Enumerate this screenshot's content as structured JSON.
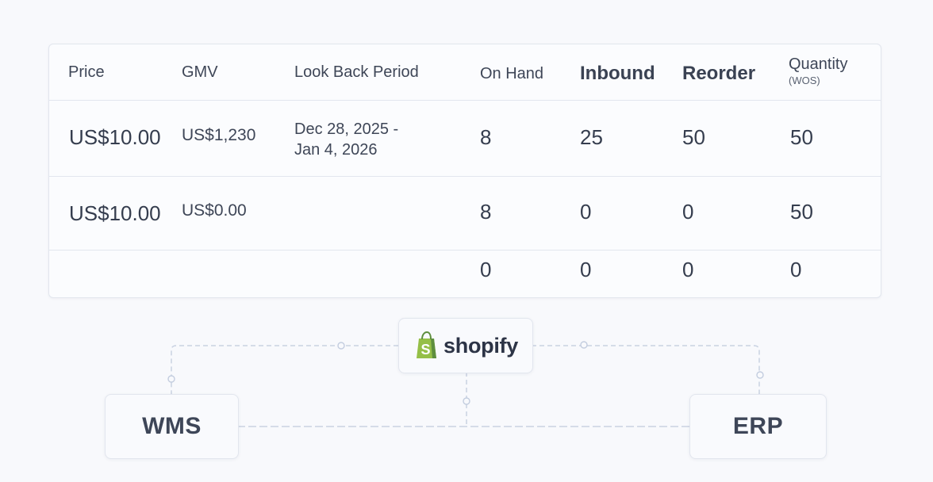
{
  "table": {
    "headers": {
      "price": "Price",
      "gmv": "GMV",
      "look_back_period": "Look Back Period",
      "on_hand": "On Hand",
      "inbound": "Inbound",
      "reorder": "Reorder",
      "quantity": "Quantity",
      "quantity_sub": "(WOS)"
    },
    "rows": [
      {
        "price": "US$10.00",
        "gmv": "US$1,230",
        "period_line1": "Dec 28, 2025 -",
        "period_line2": "Jan 4, 2026",
        "on_hand": "8",
        "inbound": "25",
        "reorder": "50",
        "quantity": "50"
      },
      {
        "price": "US$10.00",
        "gmv": "US$0.00",
        "period_line1": "",
        "period_line2": "",
        "on_hand": "8",
        "inbound": "0",
        "reorder": "0",
        "quantity": "50"
      },
      {
        "price": "",
        "gmv": "",
        "period_line1": "",
        "period_line2": "",
        "on_hand": "0",
        "inbound": "0",
        "reorder": "0",
        "quantity": "0"
      }
    ]
  },
  "integrations": {
    "shopify_label": "shopify",
    "shopify_icon": "shopify-bag-icon",
    "wms_label": "WMS",
    "erp_label": "ERP",
    "brand_green": "#95bf47",
    "brand_green_dark": "#5e8e3e"
  }
}
